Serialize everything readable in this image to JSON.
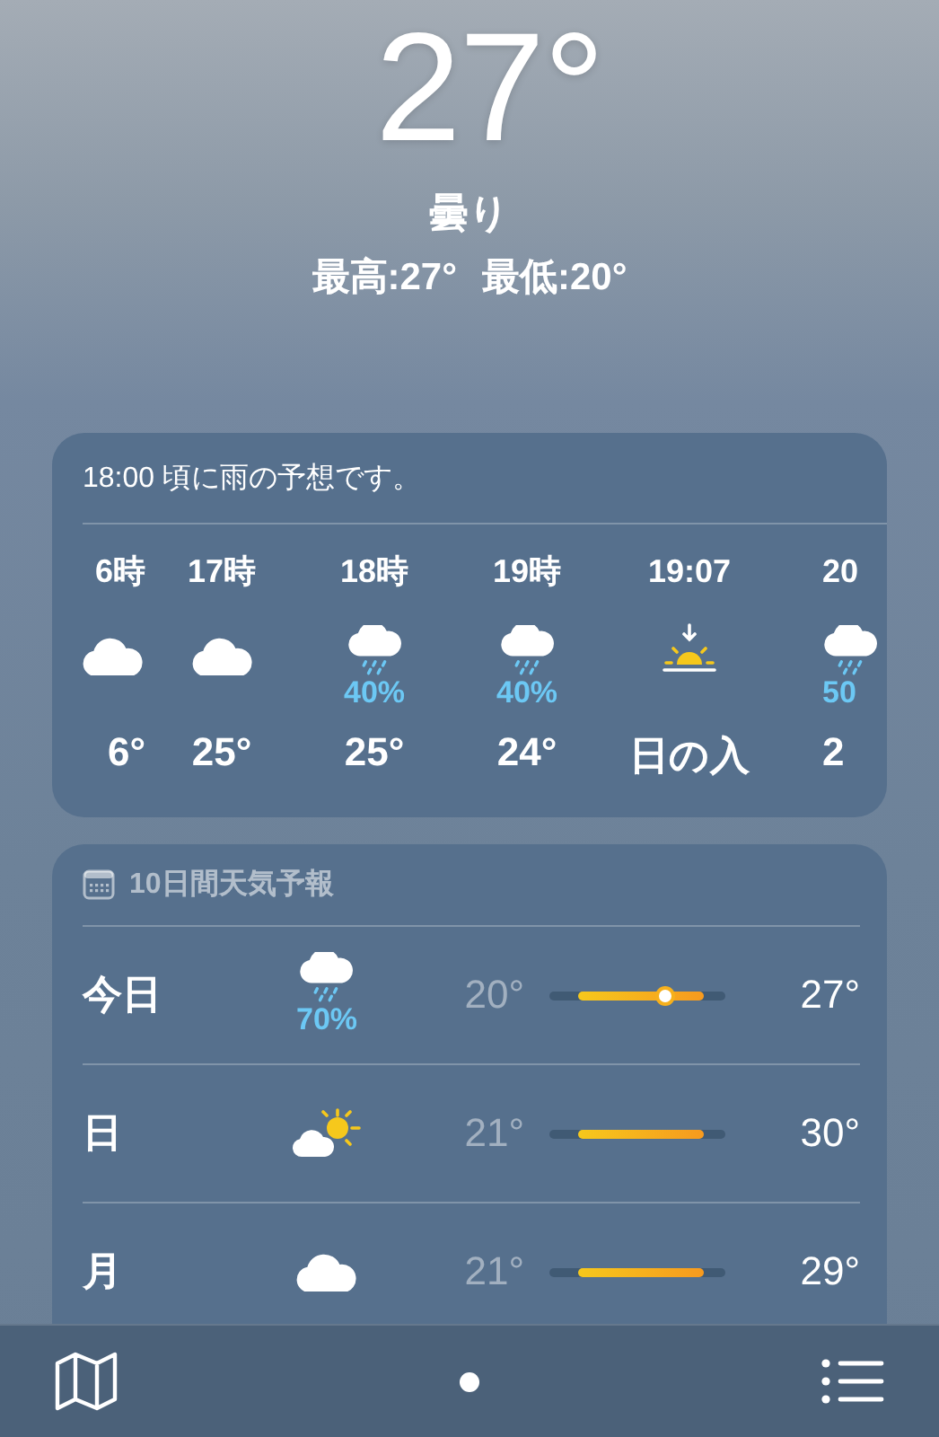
{
  "current": {
    "temperature": "27°",
    "condition": "曇り",
    "high": "最高:27°",
    "low": "最低:20°"
  },
  "hourly": {
    "summary": "18:00 頃に雨の予想です。",
    "hours": [
      {
        "time": "6時",
        "kind": "cloud",
        "temp": "6°"
      },
      {
        "time": "17時",
        "kind": "cloud",
        "temp": "25°"
      },
      {
        "time": "18時",
        "kind": "rain",
        "chance": "40%",
        "temp": "25°"
      },
      {
        "time": "19時",
        "kind": "rain",
        "chance": "40%",
        "temp": "24°"
      },
      {
        "time": "19:07",
        "kind": "sunset",
        "temp": "日の入"
      },
      {
        "time": "20",
        "kind": "rain",
        "chance": "50",
        "temp": "2"
      }
    ]
  },
  "daily": {
    "title": "10日間天気予報",
    "days": [
      {
        "day": "今日",
        "kind": "rain",
        "chance": "70%",
        "low": "20°",
        "high": "27°",
        "now_marker": true
      },
      {
        "day": "日",
        "kind": "partly_sunny",
        "low": "21°",
        "high": "30°",
        "now_marker": false
      },
      {
        "day": "月",
        "kind": "cloud",
        "low": "21°",
        "high": "29°",
        "now_marker": false
      }
    ]
  }
}
